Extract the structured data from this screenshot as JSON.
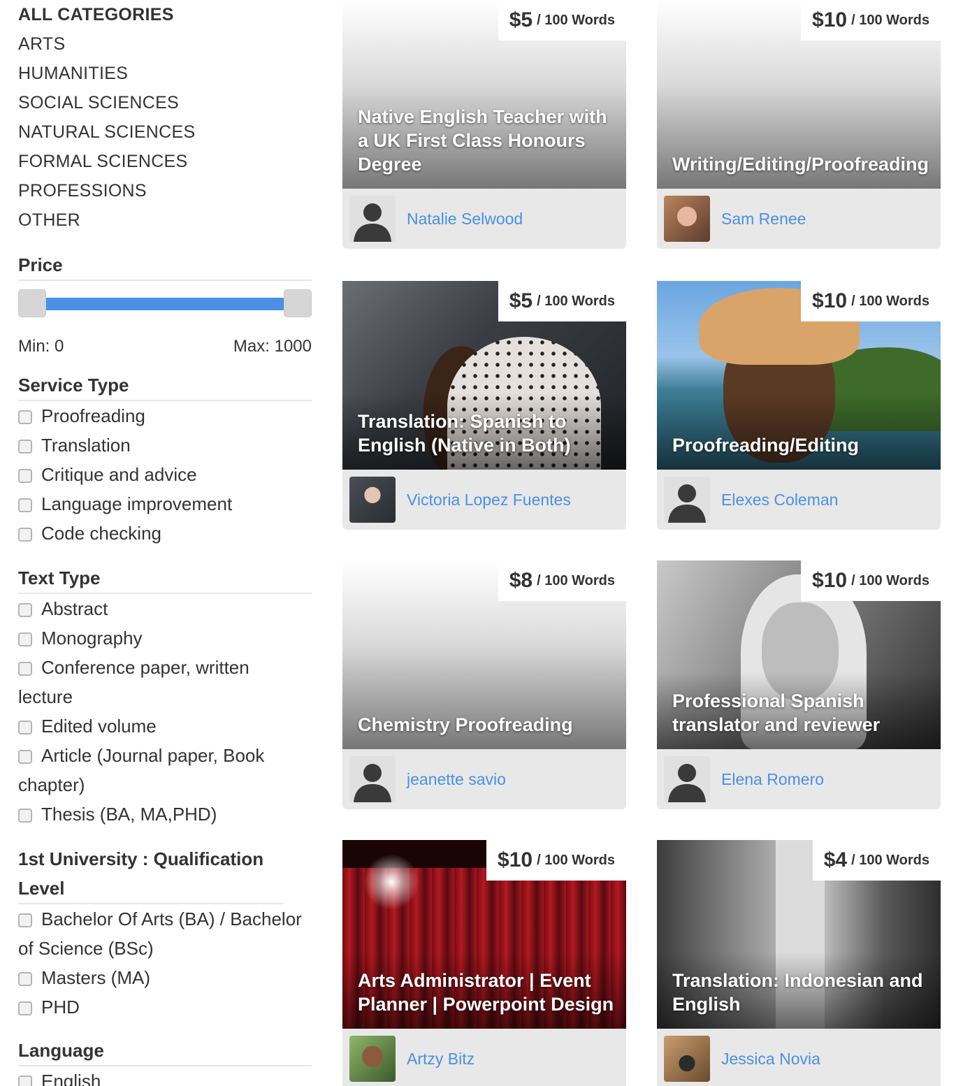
{
  "sidebar": {
    "categories": [
      {
        "label": "ALL CATEGORIES",
        "active": true
      },
      {
        "label": "ARTS"
      },
      {
        "label": "HUMANITIES"
      },
      {
        "label": "SOCIAL SCIENCES"
      },
      {
        "label": "NATURAL SCIENCES"
      },
      {
        "label": "FORMAL SCIENCES"
      },
      {
        "label": "PROFESSIONS"
      },
      {
        "label": "OTHER"
      }
    ],
    "price": {
      "title": "Price",
      "min_label": "Min: 0",
      "max_label": "Max: 1000",
      "min_value": 0,
      "max_value": 1000
    },
    "service_type": {
      "title": "Service Type",
      "options": [
        "Proofreading",
        "Translation",
        "Critique and advice",
        "Language improvement",
        "Code checking"
      ]
    },
    "text_type": {
      "title": "Text Type",
      "options": [
        "Abstract",
        "Monography",
        "Conference paper, written lecture",
        "Edited volume",
        "Article (Journal paper, Book chapter)",
        "Thesis (BA, MA,PHD)"
      ]
    },
    "qualification": {
      "title": "1st University : Qualification Level",
      "options": [
        "Bachelor Of Arts (BA) / Bachelor of Science (BSc)",
        "Masters (MA)",
        "PHD"
      ]
    },
    "language": {
      "title": "Language",
      "options": [
        "English"
      ]
    }
  },
  "cards": [
    {
      "price": "$5",
      "unit": "/ 100 Words",
      "title": "Native English Teacher with a UK First Class Honours Degree",
      "author": "Natalie Selwood"
    },
    {
      "price": "$10",
      "unit": "/ 100 Words",
      "title": "Writing/Editing/Proofreading",
      "author": "Sam Renee"
    },
    {
      "price": "$5",
      "unit": "/ 100 Words",
      "title": "Translation: Spanish to English (Native in Both)",
      "author": "Victoria Lopez Fuentes"
    },
    {
      "price": "$10",
      "unit": "/ 100 Words",
      "title": "Proofreading/Editing",
      "author": "Elexes Coleman"
    },
    {
      "price": "$8",
      "unit": "/ 100 Words",
      "title": "Chemistry Proofreading",
      "author": "jeanette savio"
    },
    {
      "price": "$10",
      "unit": "/ 100 Words",
      "title": "Professional Spanish translator and reviewer",
      "author": "Elena Romero"
    },
    {
      "price": "$10",
      "unit": "/ 100 Words",
      "title": "Arts Administrator | Event Planner | Powerpoint Design",
      "author": "Artzy Bitz"
    },
    {
      "price": "$4",
      "unit": "/ 100 Words",
      "title": "Translation: Indonesian and English",
      "author": "Jessica Novia"
    }
  ],
  "colors": {
    "accent": "#4a90e2",
    "text": "#333333",
    "card_footer_bg": "#e8e8e8"
  }
}
